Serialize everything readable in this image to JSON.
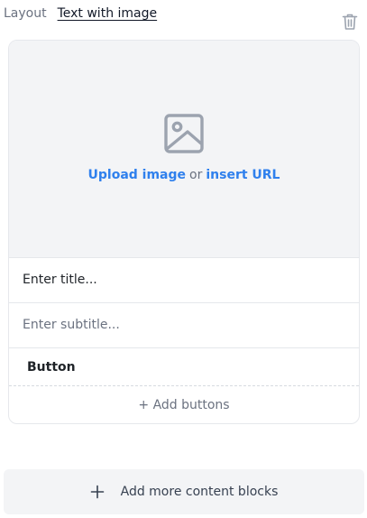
{
  "layout": {
    "label": "Layout",
    "value": "Text with image"
  },
  "image_block": {
    "upload_link": "Upload image",
    "or_text": "or",
    "url_link": "insert URL",
    "icon": "image-icon"
  },
  "fields": {
    "title_placeholder": "Enter title...",
    "subtitle_placeholder": "Enter subtitle..."
  },
  "buttons": {
    "items": [
      "Button"
    ],
    "add_label": "+ Add buttons"
  },
  "footer": {
    "add_more_label": "Add more content blocks",
    "icon": "plus-icon"
  },
  "colors": {
    "link": "#2f80ed",
    "image_bg": "#f3f4f6",
    "icon_gray": "#9ca3af"
  }
}
